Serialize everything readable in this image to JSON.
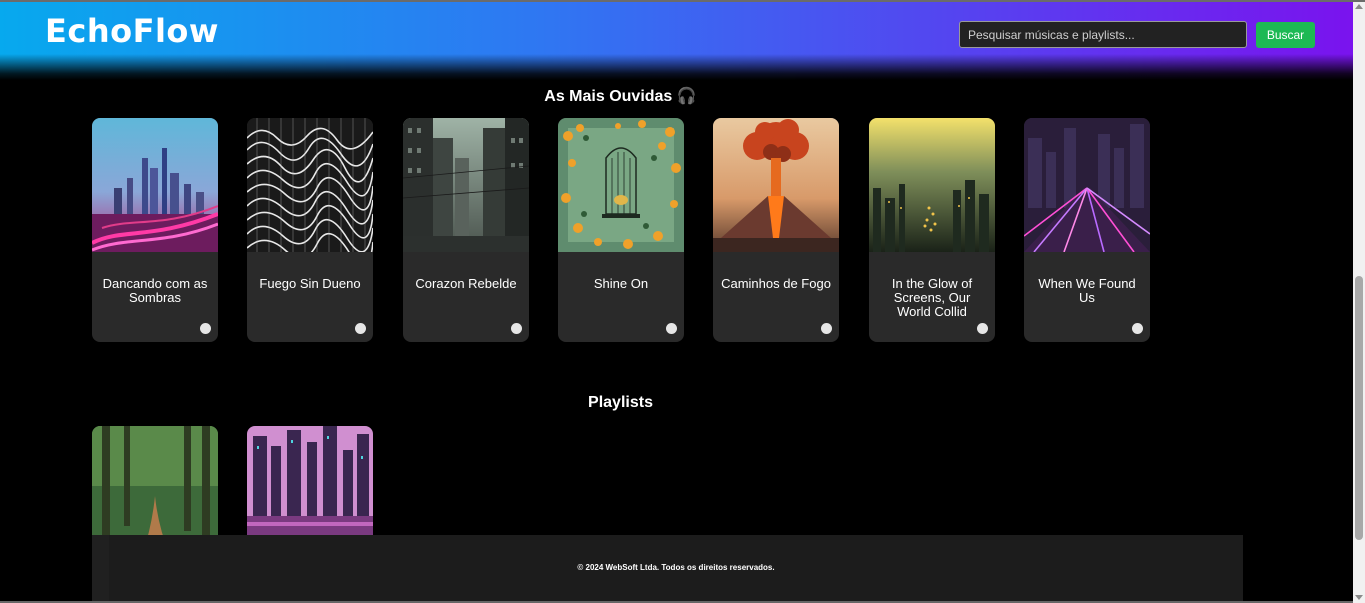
{
  "header": {
    "logo": "EchoFlow",
    "search_placeholder": "Pesquisar músicas e playlists...",
    "search_button": "Buscar"
  },
  "top_songs": {
    "title": "As Mais Ouvidas 🎧",
    "items": [
      {
        "title": "Dancando com as Sombras"
      },
      {
        "title": "Fuego Sin Dueno"
      },
      {
        "title": "Corazon Rebelde"
      },
      {
        "title": "Shine On"
      },
      {
        "title": "Caminhos de Fogo"
      },
      {
        "title": "In the Glow of Screens, Our World Collid"
      },
      {
        "title": "When We Found Us"
      }
    ]
  },
  "playlists": {
    "title": "Playlists"
  },
  "footer": {
    "copyright": "© 2024 WebSoft Ltda. Todos os direitos reservados."
  },
  "colors": {
    "accent": "#1db954",
    "header_gradient_start": "#07a9ee",
    "header_gradient_end": "#7a13ee",
    "card_bg": "#2a2a2a"
  }
}
